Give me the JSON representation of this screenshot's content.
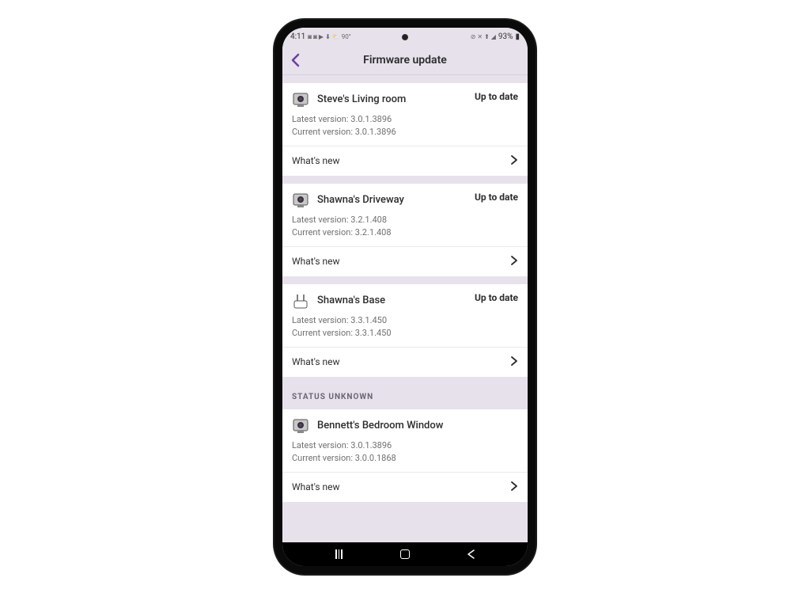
{
  "status_bar": {
    "time": "4:11",
    "icons_left": "◙ ◙ ▶ ⬇ ⛅ 90°",
    "icons_right": "⊘ ✕ ⟳ ◢ 93% ■",
    "battery": "93%"
  },
  "header": {
    "title": "Firmware update"
  },
  "devices": [
    {
      "name": "Steve's Living room",
      "status": "Up to date",
      "latest_label": "Latest version: 3.0.1.3896",
      "current_label": "Current version: 3.0.1.3896",
      "whats_new": "What's new",
      "icon": "camera"
    },
    {
      "name": "Shawna's Driveway",
      "status": "Up to date",
      "latest_label": "Latest version: 3.2.1.408",
      "current_label": "Current version: 3.2.1.408",
      "whats_new": "What's new",
      "icon": "camera"
    },
    {
      "name": "Shawna's Base",
      "status": "Up to date",
      "latest_label": "Latest version: 3.3.1.450",
      "current_label": "Current version: 3.3.1.450",
      "whats_new": "What's new",
      "icon": "base"
    }
  ],
  "section_unknown": {
    "label": "STATUS UNKNOWN"
  },
  "unknown_devices": [
    {
      "name": "Bennett's Bedroom Window",
      "latest_label": "Latest version: 3.0.1.3896",
      "current_label": "Current version: 3.0.0.1868",
      "whats_new": "What's new",
      "icon": "camera"
    }
  ]
}
